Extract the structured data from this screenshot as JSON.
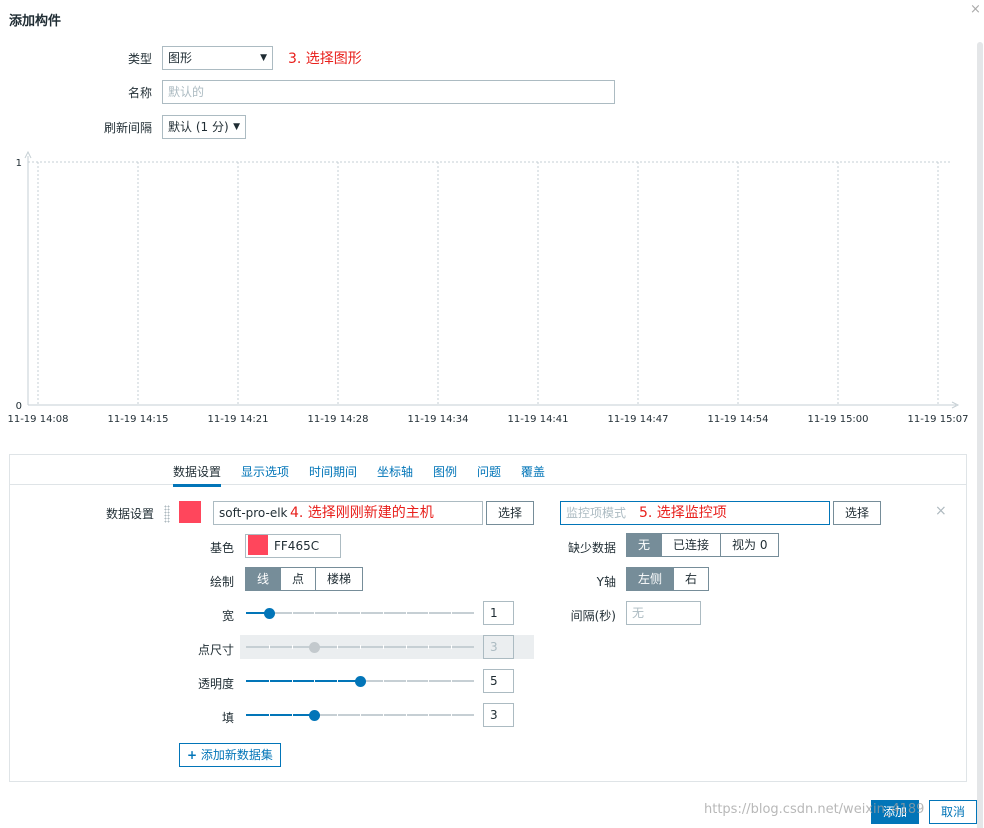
{
  "dialog": {
    "title": "添加构件",
    "close": "×"
  },
  "form": {
    "type_label": "类型",
    "type_value": "图形",
    "type_annotation": "3. 选择图形",
    "name_label": "名称",
    "name_placeholder": "默认的",
    "refresh_label": "刷新间隔",
    "refresh_value": "默认 (1 分)",
    "caret": "▼"
  },
  "chart_data": {
    "type": "line",
    "x": [
      "11-19 14:08",
      "11-19 14:15",
      "11-19 14:21",
      "11-19 14:28",
      "11-19 14:34",
      "11-19 14:41",
      "11-19 14:47",
      "11-19 14:54",
      "11-19 15:00",
      "11-19 15:07"
    ],
    "yticks": [
      "0",
      "1"
    ],
    "ylim": [
      0,
      1
    ],
    "grid": true,
    "series": []
  },
  "tabs": [
    {
      "label": "数据设置",
      "active": true
    },
    {
      "label": "显示选项",
      "active": false
    },
    {
      "label": "时间期间",
      "active": false
    },
    {
      "label": "坐标轴",
      "active": false
    },
    {
      "label": "图例",
      "active": false
    },
    {
      "label": "问题",
      "active": false
    },
    {
      "label": "覆盖",
      "active": false
    }
  ],
  "dataset": {
    "section_label": "数据设置",
    "color": "#ff465c",
    "host_value": "soft-pro-elk",
    "host_annotation": "4. 选择刚刚新建的主机",
    "select_host_btn": "选择",
    "item_placeholder": "监控项模式",
    "item_annotation": "5. 选择监控项",
    "select_item_btn": "选择",
    "remove": "×",
    "base_color_label": "基色",
    "base_color_value": "FF465C",
    "draw_label": "绘制",
    "draw_options": [
      "线",
      "点",
      "楼梯"
    ],
    "draw_selected": 0,
    "width_label": "宽",
    "width_value": "1",
    "width_max": 10,
    "point_size_label": "点尺寸",
    "point_size_value": "3",
    "transparency_label": "透明度",
    "transparency_value": "5",
    "fill_label": "填",
    "fill_value": "3",
    "missing_label": "缺少数据",
    "missing_options": [
      "无",
      "已连接",
      "视为 0"
    ],
    "missing_selected": 0,
    "yaxis_label": "Y轴",
    "yaxis_options": [
      "左侧",
      "右"
    ],
    "yaxis_selected": 0,
    "interval_label": "间隔(秒)",
    "interval_placeholder": "无",
    "add_dataset": "添加新数据集",
    "add_icon": "+"
  },
  "footer": {
    "add": "添加",
    "cancel": "取消"
  },
  "watermark": "https://blog.csdn.net/weixin_4189"
}
